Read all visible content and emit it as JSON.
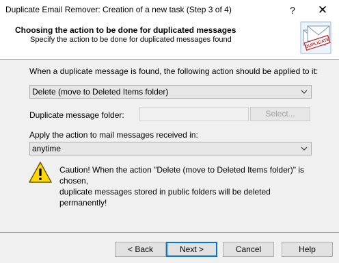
{
  "window": {
    "title": "Duplicate Email Remover: Creation of a new task (Step 3 of 4)",
    "help_glyph": "?",
    "close_glyph": "✕"
  },
  "header": {
    "title": "Choosing the action to be done for duplicated messages",
    "subtitle": "Specify the action to be done for duplicated messages found",
    "icon": "duplicate-envelope-icon",
    "icon_stamp_text": "DUPLICATE"
  },
  "form": {
    "action_label": "When a duplicate message is found, the following action should be applied to it:",
    "action_value": "Delete (move to Deleted Items folder)",
    "folder_label": "Duplicate message folder:",
    "folder_value": "",
    "select_button": "Select...",
    "period_label": "Apply the action to mail messages received in:",
    "period_value": "anytime"
  },
  "warning": {
    "icon": "warning-icon",
    "line1": "Caution! When the action \"Delete (move to Deleted Items folder)\" is chosen,",
    "line2": "duplicate messages stored in public folders will be deleted permanently!"
  },
  "buttons": {
    "back": "< Back",
    "next": "Next >",
    "cancel": "Cancel",
    "help": "Help"
  },
  "colors": {
    "accent": "#0078d7",
    "warning_yellow": "#ffd800",
    "stamp_red": "#c0262d"
  }
}
